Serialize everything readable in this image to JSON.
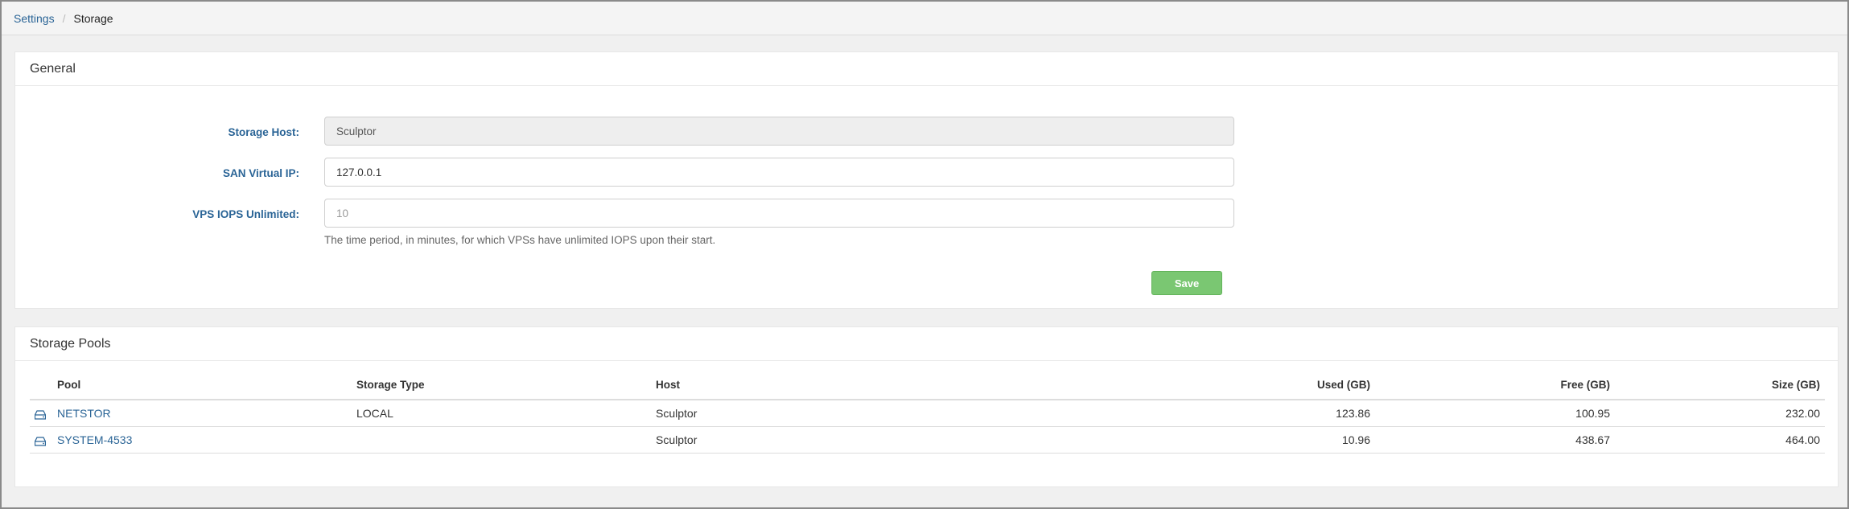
{
  "breadcrumb": {
    "parent": "Settings",
    "separator": "/",
    "current": "Storage"
  },
  "general": {
    "title": "General",
    "fields": {
      "storage_host": {
        "label": "Storage Host:",
        "value": "Sculptor"
      },
      "san_virtual_ip": {
        "label": "SAN Virtual IP:",
        "value": "127.0.0.1"
      },
      "vps_iops_unlimited": {
        "label": "VPS IOPS Unlimited:",
        "placeholder": "10"
      }
    },
    "help_text": "The time period, in minutes, for which VPSs have unlimited IOPS upon their start.",
    "save_label": "Save"
  },
  "storage_pools": {
    "title": "Storage Pools",
    "columns": {
      "pool": "Pool",
      "storage_type": "Storage Type",
      "host": "Host",
      "used": "Used (GB)",
      "free": "Free (GB)",
      "size": "Size (GB)"
    },
    "rows": [
      {
        "icon": "disk-icon",
        "pool": "NETSTOR",
        "storage_type": "LOCAL",
        "host": "Sculptor",
        "used": "123.86",
        "free": "100.95",
        "size": "232.00"
      },
      {
        "icon": "disk-icon",
        "pool": "SYSTEM-4533",
        "storage_type": "",
        "host": "Sculptor",
        "used": "10.96",
        "free": "438.67",
        "size": "464.00"
      }
    ]
  },
  "colors": {
    "link": "#2a6496",
    "save_button": "#7ac772"
  }
}
